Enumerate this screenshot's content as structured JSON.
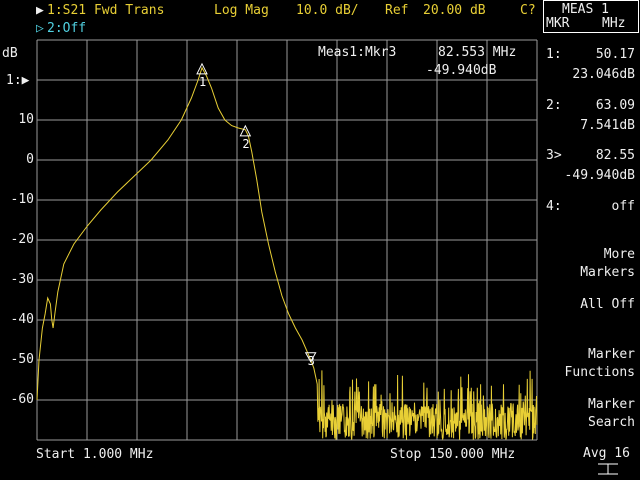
{
  "header": {
    "ch1_marker": "▶",
    "ch1_label": "1:S21 Fwd Trans",
    "format": "Log Mag",
    "scale": "10.0 dB/",
    "ref_label": "Ref",
    "ref_value": "20.00 dB",
    "cal_status": "C?",
    "ch2_marker": "▷",
    "ch2_label": "2:Off"
  },
  "plot": {
    "y_unit": "dB",
    "ref_marker": "1:▶",
    "y_ticks": [
      "10",
      "0",
      "-10",
      "-20",
      "-30",
      "-40",
      "-50",
      "-60"
    ],
    "start_label": "Start 1.000 MHz",
    "stop_label": "Stop 150.000 MHz",
    "active_marker": {
      "title": "Meas1:Mkr3",
      "freq": "82.553 MHz",
      "value": "-49.940dB"
    },
    "marker_tags": [
      "1",
      "2",
      "3"
    ],
    "trace_color": "#e8cf35"
  },
  "side": {
    "meas_title": "MEAS 1",
    "meas_sub_left": "MKR",
    "meas_sub_right": "MHz",
    "markers": [
      {
        "id": "1:",
        "freq": "50.17",
        "value": "23.046dB"
      },
      {
        "id": "2:",
        "freq": "63.09",
        "value": "7.541dB"
      },
      {
        "id": "3>",
        "freq": "82.55",
        "value": "-49.940dB"
      },
      {
        "id": "4:",
        "freq": "off",
        "value": ""
      }
    ],
    "buttons": [
      {
        "line1": "More",
        "line2": "Markers"
      },
      {
        "line1": "All Off",
        "line2": ""
      },
      {
        "line1": "Marker",
        "line2": "Functions"
      },
      {
        "line1": "Marker",
        "line2": "Search"
      }
    ],
    "avg_label": "Avg 16"
  }
}
